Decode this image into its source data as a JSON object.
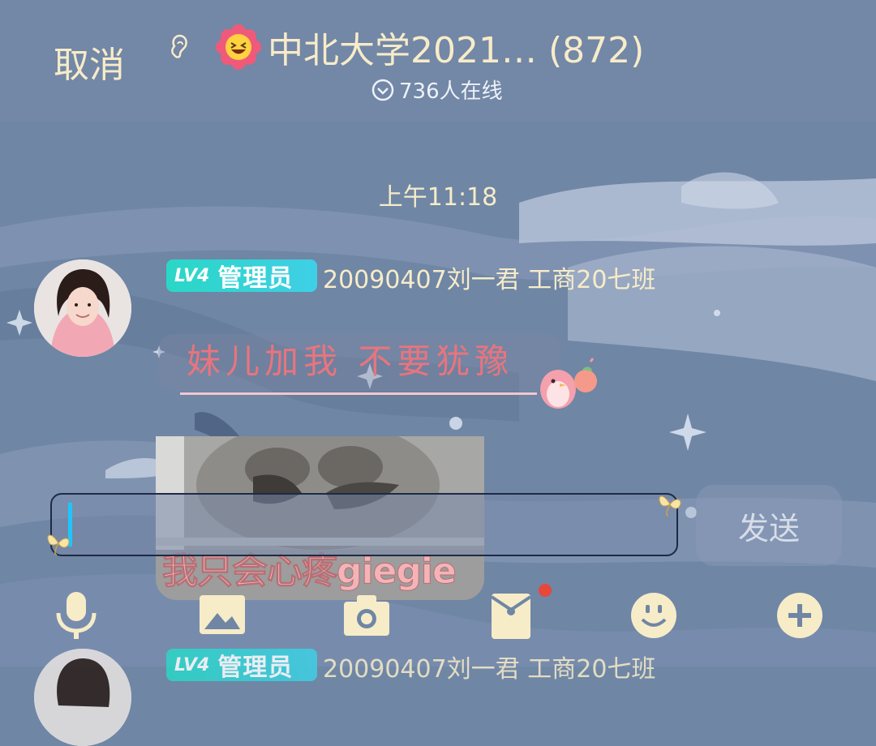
{
  "header": {
    "cancel_label": "取消",
    "group_title": "中北大学2021… (872)",
    "online_count": "736人在线"
  },
  "chat": {
    "timestamp": "上午11:18",
    "messages": [
      {
        "badge_level": "LV4",
        "badge_role": "管理员",
        "sender": "20090407刘一君 工商20七班",
        "text": "妹儿加我 不要犹豫",
        "image_caption": "我只会心疼giegie"
      },
      {
        "badge_level": "LV4",
        "badge_role": "管理员",
        "sender": "20090407刘一君 工商20七班"
      }
    ]
  },
  "input": {
    "value": "",
    "send_label": "发送"
  },
  "toolbar": {
    "items": [
      "microphone-icon",
      "image-icon",
      "camera-icon",
      "red-packet-icon",
      "emoji-icon",
      "plus-icon"
    ]
  },
  "colors": {
    "background": "#6f86a5",
    "header_text": "#f7ecc8",
    "badge": "#2ad7c6",
    "bubble_text": "#e9747e",
    "caret": "#1fc5ff",
    "notify_dot": "#e8473b"
  }
}
